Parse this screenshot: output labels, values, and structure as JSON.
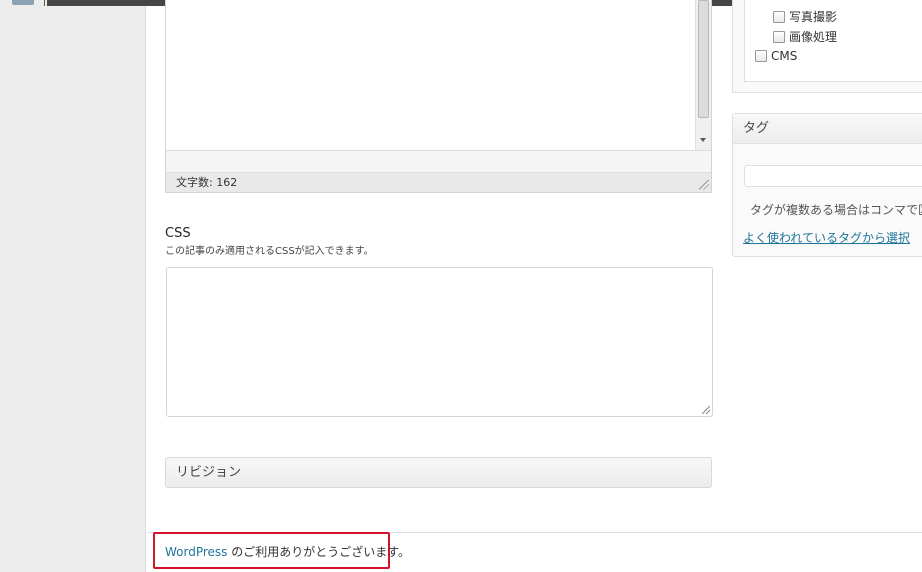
{
  "editor": {
    "word_count_label": "文字数: 162"
  },
  "css_section": {
    "title": "CSS",
    "description": "この記事のみ適用されるCSSが記入できます。",
    "value": ""
  },
  "revisions": {
    "title": "リビジョン"
  },
  "footer": {
    "link_text": "WordPress",
    "thanks_text": " のご利用ありがとうございます。"
  },
  "categories": {
    "items": [
      {
        "label": "写真撮影",
        "checked": false
      },
      {
        "label": "画像処理",
        "checked": false
      },
      {
        "label": "CMS",
        "checked": false
      }
    ]
  },
  "tags": {
    "title": "タグ",
    "input_value": "",
    "hint": "タグが複数ある場合はコンマで区切",
    "popular_link": "よく使われているタグから選択"
  },
  "colors": {
    "link": "#21759b",
    "highlight_border": "#d6132c",
    "admin_bar": "#464646"
  }
}
